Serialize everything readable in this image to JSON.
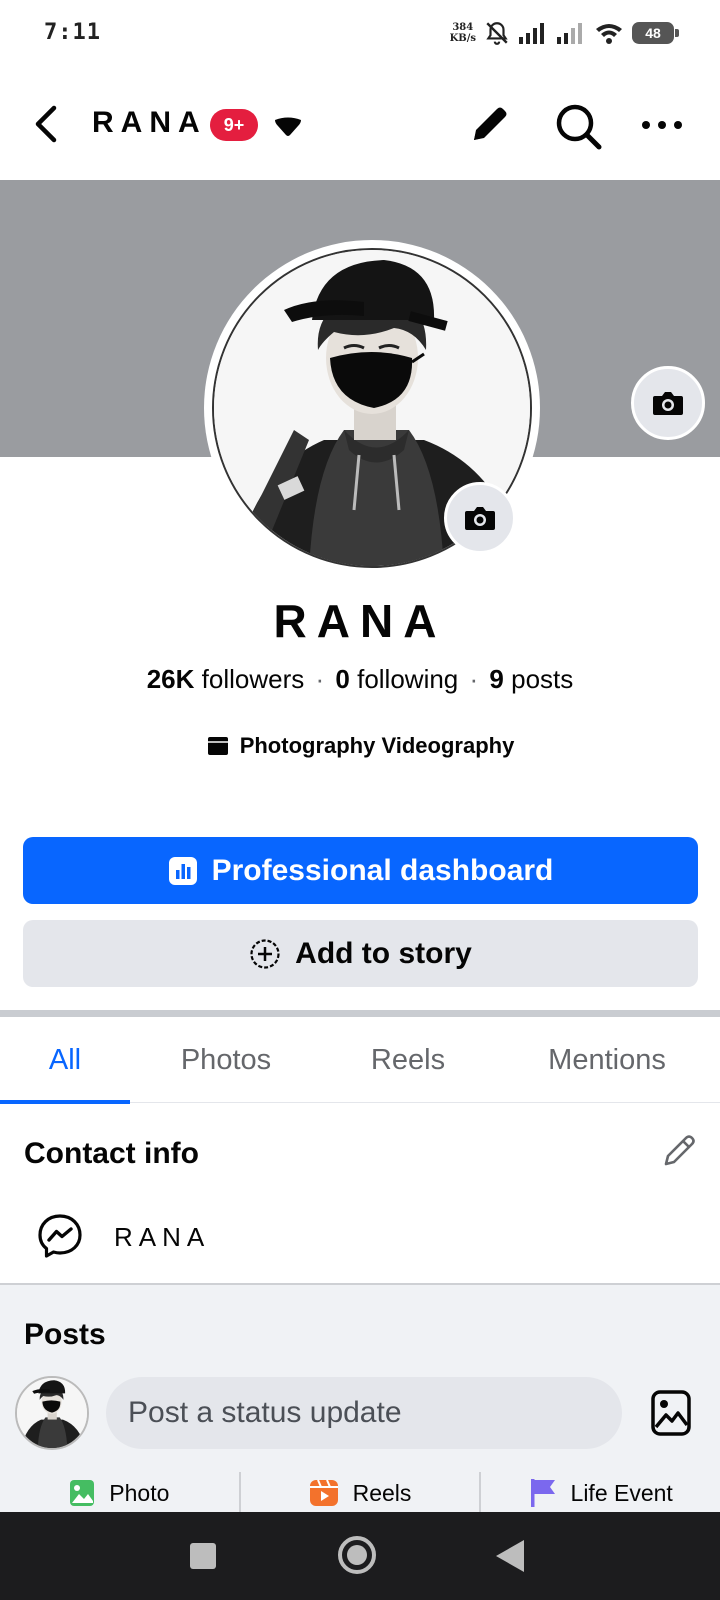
{
  "status_bar": {
    "time": "7:11",
    "net_speed_value": "384",
    "net_speed_unit": "KB/s",
    "battery": "48"
  },
  "header": {
    "title": "RANA",
    "badge": "9+"
  },
  "profile": {
    "name": "RANA",
    "followers_count": "26K",
    "followers_label": "followers",
    "following_count": "0",
    "following_label": "following",
    "posts_count": "9",
    "posts_label": "posts",
    "separator": "·",
    "category": "Photography Videography"
  },
  "buttons": {
    "primary": "Professional dashboard",
    "secondary": "Add to story"
  },
  "tabs": [
    {
      "label": "All",
      "active": true
    },
    {
      "label": "Photos",
      "active": false
    },
    {
      "label": "Reels",
      "active": false
    },
    {
      "label": "Mentions",
      "active": false
    }
  ],
  "contact": {
    "title": "Contact info",
    "messenger_value": "RANA"
  },
  "posts": {
    "title": "Posts",
    "status_placeholder": "Post a status update",
    "actions": [
      {
        "label": "Photo",
        "icon": "photo-icon",
        "color": "#45bd62"
      },
      {
        "label": "Reels",
        "icon": "reels-icon",
        "color": "#f3722c"
      },
      {
        "label": "Life Event",
        "icon": "flag-icon",
        "color": "#7b68ee"
      }
    ]
  },
  "colors": {
    "accent": "#0866ff",
    "badge": "#e41e3f",
    "cover": "#9a9ca0"
  }
}
